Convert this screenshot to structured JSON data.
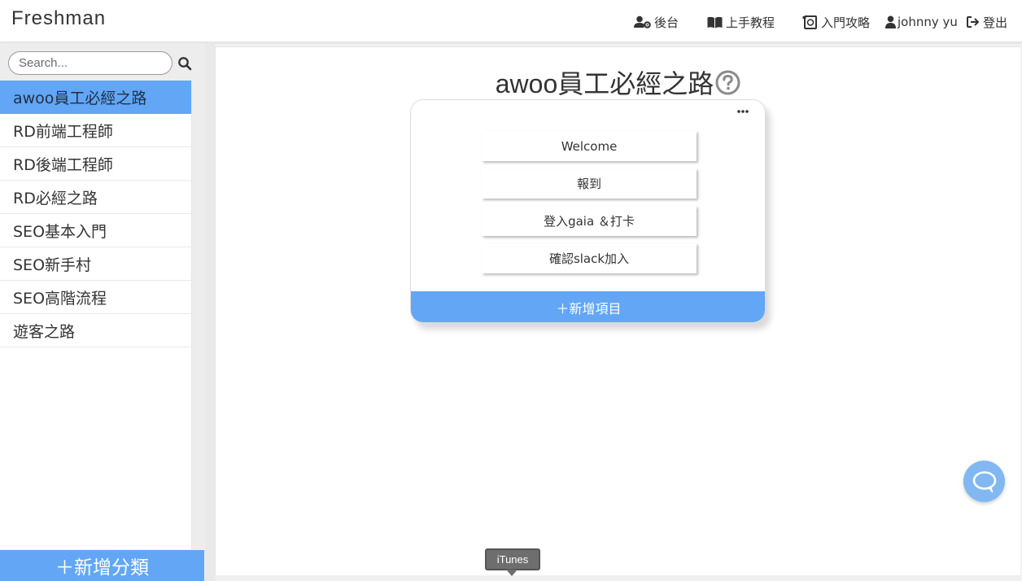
{
  "header": {
    "brand": "Freshman",
    "nav": [
      {
        "label": "後台",
        "icon": "user-gear-icon"
      },
      {
        "label": "上手教程",
        "icon": "book-open-icon"
      },
      {
        "label": "入門攻略",
        "icon": "book-atlas-icon"
      },
      {
        "label": "johnny yu",
        "icon": "user-icon"
      },
      {
        "label": "登出",
        "icon": "sign-out-icon"
      }
    ]
  },
  "sidebar": {
    "search_placeholder": "Search...",
    "search_icon": "search-icon",
    "categories": [
      {
        "label": "awoo員工必經之路",
        "active": true
      },
      {
        "label": "RD前端工程師",
        "active": false
      },
      {
        "label": "RD後端工程師",
        "active": false
      },
      {
        "label": "RD必經之路",
        "active": false
      },
      {
        "label": "SEO基本入門",
        "active": false
      },
      {
        "label": "SEO新手村",
        "active": false
      },
      {
        "label": "SEO高階流程",
        "active": false
      },
      {
        "label": "遊客之路",
        "active": false
      }
    ],
    "add_category_label": "＋新增分類"
  },
  "main": {
    "title": "awoo員工必經之路",
    "help_icon": "question-circle-icon",
    "card": {
      "more_icon": "ellipsis-icon",
      "items": [
        "Welcome",
        "報到",
        "登入gaia ＆打卡",
        "確認slack加入"
      ],
      "add_item_label": "＋新增項目"
    }
  },
  "chat_icon": "chat-bubble-icon",
  "tooltip": "iTunes",
  "colors": {
    "accent": "#62a6f5",
    "chat": "#82b8f2",
    "tooltip_bg": "#6e6e6e"
  }
}
